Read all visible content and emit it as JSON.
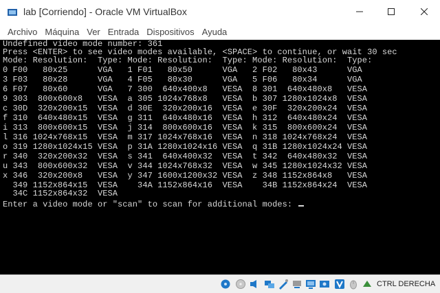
{
  "window": {
    "title": "lab [Corriendo] - Oracle VM VirtualBox"
  },
  "menu": [
    "Archivo",
    "Máquina",
    "Ver",
    "Entrada",
    "Dispositivos",
    "Ayuda"
  ],
  "console": {
    "lines": [
      "Undefined video mode number: 361",
      "Press <ENTER> to see video modes available, <SPACE> to continue, or wait 30 sec",
      "Mode: Resolution:  Type: Mode: Resolution:  Type: Mode: Resolution:  Type:",
      "0 F00   80x25      VGA   1 F01   80x50      VGA   2 F02   80x43      VGA",
      "3 F03   80x28      VGA   4 F05   80x30      VGA   5 F06   80x34      VGA",
      "6 F07   80x60      VGA   7 300  640x400x8   VESA  8 301  640x480x8   VESA",
      "9 303  800x600x8   VESA  a 305 1024x768x8   VESA  b 307 1280x1024x8  VESA",
      "c 30D  320x200x15  VESA  d 30E  320x200x16  VESA  e 30F  320x200x24  VESA",
      "f 310  640x480x15  VESA  g 311  640x480x16  VESA  h 312  640x480x24  VESA",
      "i 313  800x600x15  VESA  j 314  800x600x16  VESA  k 315  800x600x24  VESA",
      "l 316 1024x768x15  VESA  m 317 1024x768x16  VESA  n 318 1024x768x24  VESA",
      "o 319 1280x1024x15 VESA  p 31A 1280x1024x16 VESA  q 31B 1280x1024x24 VESA",
      "r 340  320x200x32  VESA  s 341  640x400x32  VESA  t 342  640x480x32  VESA",
      "u 343  800x600x32  VESA  v 344 1024x768x32  VESA  w 345 1280x1024x32 VESA",
      "x 346  320x200x8   VESA  y 347 1600x1200x32 VESA  z 348 1152x864x8   VESA",
      "  349 1152x864x15  VESA    34A 1152x864x16  VESA    34B 1152x864x24  VESA",
      "  34C 1152x864x32  VESA",
      "Enter a video mode or \"scan\" to scan for additional modes: "
    ]
  },
  "statusbar": {
    "host_key": "CTRL DERECHA",
    "icons": [
      "usb-disk-icon",
      "optical-drive-icon",
      "audio-icon",
      "network-icon",
      "shared-folders-icon",
      "usb-icon",
      "display-icon",
      "recording-icon",
      "vt-x-icon",
      "mouse-integration-icon",
      "keyboard-icon"
    ],
    "colors": {
      "blue": "#1f78c8",
      "grey": "#9a9a9a",
      "green": "#3a8f3a"
    }
  }
}
